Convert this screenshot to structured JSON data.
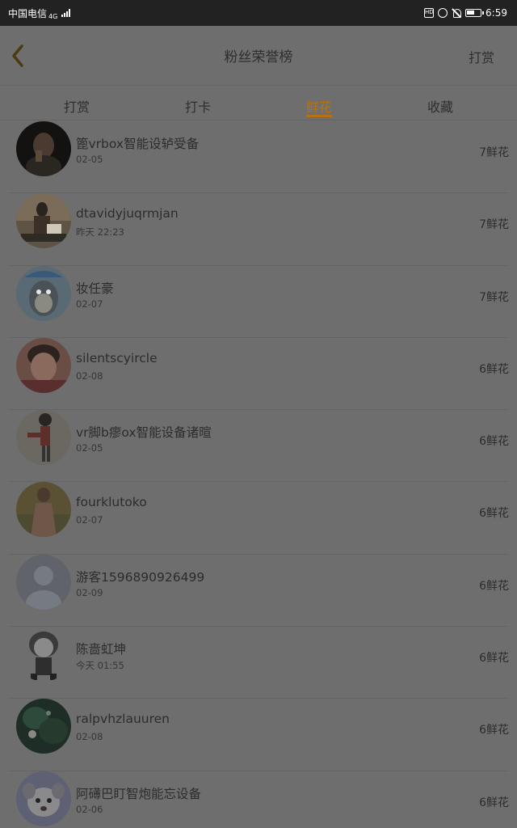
{
  "status_bar": {
    "carrier": "中国电信",
    "network": "4G",
    "time": "6:59"
  },
  "header": {
    "back_icon": "chevron-left-icon",
    "title": "粉丝荣誉榜",
    "action_label": "打赏"
  },
  "tabs": [
    {
      "label": "打赏",
      "active": false
    },
    {
      "label": "打卡",
      "active": false
    },
    {
      "label": "鲜花",
      "active": true
    },
    {
      "label": "收藏",
      "active": false
    }
  ],
  "accent_color": "#b8710f",
  "fans": [
    {
      "name": "篦vrbox智能设轳受备",
      "time": "02-05",
      "count": "7鲜花"
    },
    {
      "name": "dtavidyjuqrmjan",
      "time": "昨天 22:23",
      "count": "7鲜花"
    },
    {
      "name": "妆任豪",
      "time": "02-07",
      "count": "7鲜花"
    },
    {
      "name": "silentscyircle",
      "time": "02-08",
      "count": "6鲜花"
    },
    {
      "name": "vr脚b瘳ox智能设备诸暄",
      "time": "02-05",
      "count": "6鲜花"
    },
    {
      "name": "fourklutoko",
      "time": "02-07",
      "count": "6鲜花"
    },
    {
      "name": "游客1596890926499",
      "time": "02-09",
      "count": "6鲜花"
    },
    {
      "name": "陈啬虹坤",
      "time": "今天 01:55",
      "count": "6鲜花"
    },
    {
      "name": "ralpvhzlauuren",
      "time": "02-08",
      "count": "6鲜花"
    },
    {
      "name": "阿礡巴盯智炮能忘设备",
      "time": "02-06",
      "count": "6鲜花"
    }
  ]
}
